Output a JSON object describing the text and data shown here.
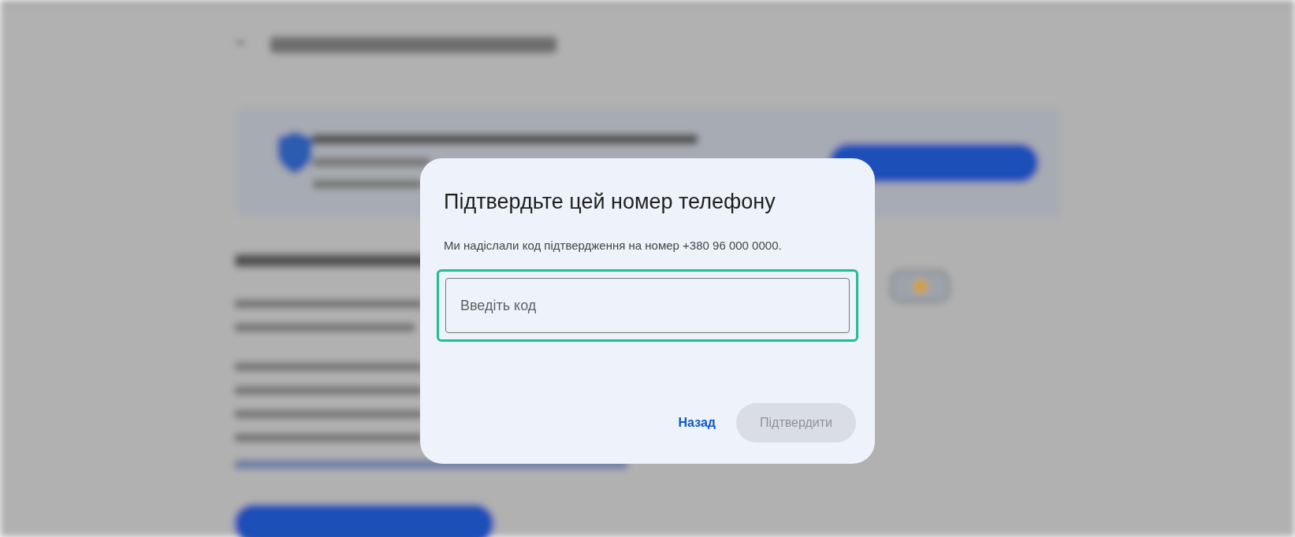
{
  "dialog": {
    "title": "Підтвердьте цей номер телефону",
    "message": "Ми надіслали код підтвердження на номер +380 96 000 0000.",
    "code_field": {
      "placeholder": "Введіть код",
      "focused": true
    },
    "buttons": [
      {
        "kind": "text",
        "label": "Назад",
        "disabled": false
      },
      {
        "kind": "filled",
        "label": "Підтвердити",
        "disabled": true
      }
    ]
  }
}
